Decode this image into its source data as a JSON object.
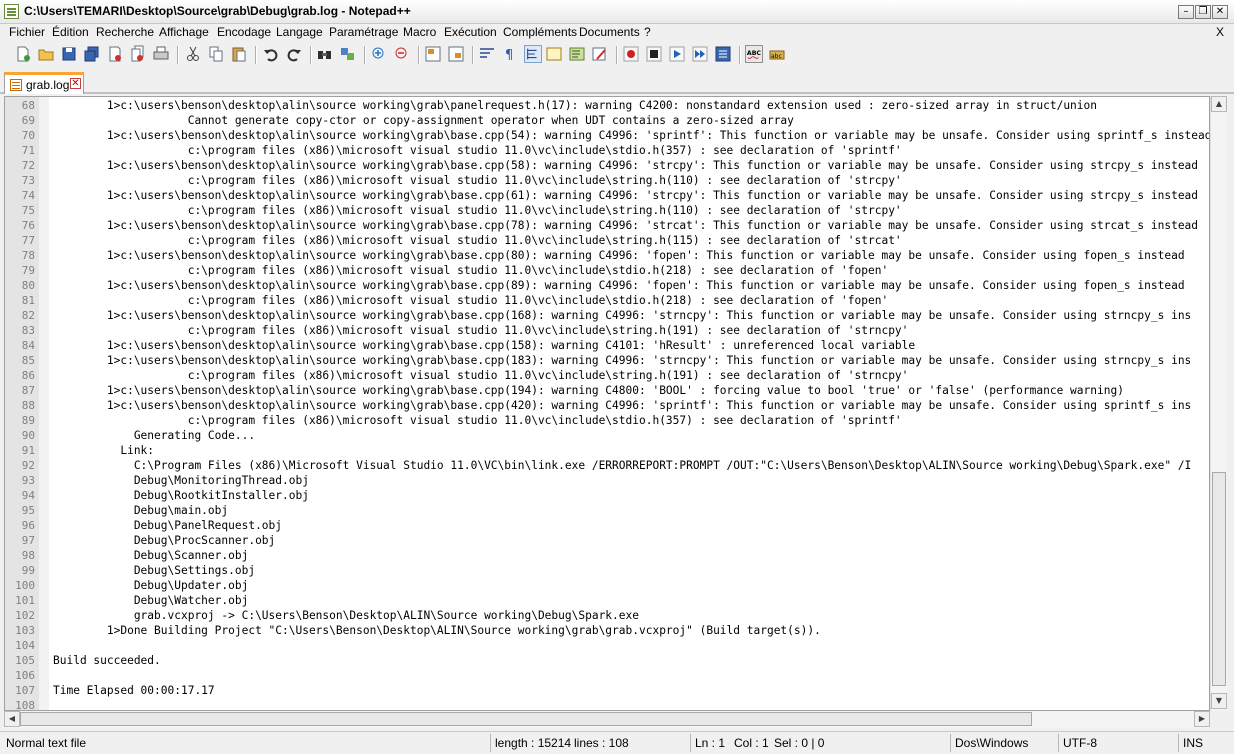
{
  "window": {
    "title": "C:\\Users\\TEMARI\\Desktop\\Source\\grab\\Debug\\grab.log - Notepad++",
    "minimize_icon": "minimize-icon",
    "restore_icon": "restore-icon",
    "close_icon": "close-icon"
  },
  "menu": {
    "items": [
      "Fichier",
      "Édition",
      "Recherche",
      "Affichage",
      "Encodage",
      "Langage",
      "Paramétrage",
      "Macro",
      "Exécution",
      "Compléments",
      "Documents",
      "?"
    ],
    "close_doc": "X"
  },
  "toolbar": {
    "buttons": [
      "new-file-icon",
      "open-file-icon",
      "save-icon",
      "save-all-icon",
      "close-icon",
      "close-all-icon",
      "print-icon",
      "cut-icon",
      "copy-icon",
      "paste-icon",
      "undo-icon",
      "redo-icon",
      "find-icon",
      "replace-icon",
      "zoom-in-icon",
      "zoom-out-icon",
      "sync-vertical-icon",
      "sync-horizontal-icon",
      "word-wrap-icon",
      "show-all-characters-icon",
      "indent-guide-icon",
      "document-map-icon",
      "function-list-icon",
      "folder-workspace-icon",
      "record-macro-icon",
      "stop-macro-icon",
      "play-macro-icon",
      "run-macro-multiple-icon",
      "save-macro-icon",
      "spell-check-icon",
      "spell-check-options-icon"
    ]
  },
  "tab": {
    "label": "grab.log",
    "icon": "document-icon",
    "close_icon": "tab-close-icon"
  },
  "editor": {
    "lines": [
      {
        "n": "68",
        "text": "        1>c:\\users\\benson\\desktop\\alin\\source working\\grab\\panelrequest.h(17): warning C4200: nonstandard extension used : zero-sized array in struct/union"
      },
      {
        "n": "69",
        "text": "                    Cannot generate copy-ctor or copy-assignment operator when UDT contains a zero-sized array"
      },
      {
        "n": "70",
        "text": "        1>c:\\users\\benson\\desktop\\alin\\source working\\grab\\base.cpp(54): warning C4996: 'sprintf': This function or variable may be unsafe. Consider using sprintf_s instead"
      },
      {
        "n": "71",
        "text": "                    c:\\program files (x86)\\microsoft visual studio 11.0\\vc\\include\\stdio.h(357) : see declaration of 'sprintf'"
      },
      {
        "n": "72",
        "text": "        1>c:\\users\\benson\\desktop\\alin\\source working\\grab\\base.cpp(58): warning C4996: 'strcpy': This function or variable may be unsafe. Consider using strcpy_s instead"
      },
      {
        "n": "73",
        "text": "                    c:\\program files (x86)\\microsoft visual studio 11.0\\vc\\include\\string.h(110) : see declaration of 'strcpy'"
      },
      {
        "n": "74",
        "text": "        1>c:\\users\\benson\\desktop\\alin\\source working\\grab\\base.cpp(61): warning C4996: 'strcpy': This function or variable may be unsafe. Consider using strcpy_s instead"
      },
      {
        "n": "75",
        "text": "                    c:\\program files (x86)\\microsoft visual studio 11.0\\vc\\include\\string.h(110) : see declaration of 'strcpy'"
      },
      {
        "n": "76",
        "text": "        1>c:\\users\\benson\\desktop\\alin\\source working\\grab\\base.cpp(78): warning C4996: 'strcat': This function or variable may be unsafe. Consider using strcat_s instead"
      },
      {
        "n": "77",
        "text": "                    c:\\program files (x86)\\microsoft visual studio 11.0\\vc\\include\\string.h(115) : see declaration of 'strcat'"
      },
      {
        "n": "78",
        "text": "        1>c:\\users\\benson\\desktop\\alin\\source working\\grab\\base.cpp(80): warning C4996: 'fopen': This function or variable may be unsafe. Consider using fopen_s instead"
      },
      {
        "n": "79",
        "text": "                    c:\\program files (x86)\\microsoft visual studio 11.0\\vc\\include\\stdio.h(218) : see declaration of 'fopen'"
      },
      {
        "n": "80",
        "text": "        1>c:\\users\\benson\\desktop\\alin\\source working\\grab\\base.cpp(89): warning C4996: 'fopen': This function or variable may be unsafe. Consider using fopen_s instead"
      },
      {
        "n": "81",
        "text": "                    c:\\program files (x86)\\microsoft visual studio 11.0\\vc\\include\\stdio.h(218) : see declaration of 'fopen'"
      },
      {
        "n": "82",
        "text": "        1>c:\\users\\benson\\desktop\\alin\\source working\\grab\\base.cpp(168): warning C4996: 'strncpy': This function or variable may be unsafe. Consider using strncpy_s ins"
      },
      {
        "n": "83",
        "text": "                    c:\\program files (x86)\\microsoft visual studio 11.0\\vc\\include\\string.h(191) : see declaration of 'strncpy'"
      },
      {
        "n": "84",
        "text": "        1>c:\\users\\benson\\desktop\\alin\\source working\\grab\\base.cpp(158): warning C4101: 'hResult' : unreferenced local variable"
      },
      {
        "n": "85",
        "text": "        1>c:\\users\\benson\\desktop\\alin\\source working\\grab\\base.cpp(183): warning C4996: 'strncpy': This function or variable may be unsafe. Consider using strncpy_s ins"
      },
      {
        "n": "86",
        "text": "                    c:\\program files (x86)\\microsoft visual studio 11.0\\vc\\include\\string.h(191) : see declaration of 'strncpy'"
      },
      {
        "n": "87",
        "text": "        1>c:\\users\\benson\\desktop\\alin\\source working\\grab\\base.cpp(194): warning C4800: 'BOOL' : forcing value to bool 'true' or 'false' (performance warning)"
      },
      {
        "n": "88",
        "text": "        1>c:\\users\\benson\\desktop\\alin\\source working\\grab\\base.cpp(420): warning C4996: 'sprintf': This function or variable may be unsafe. Consider using sprintf_s ins"
      },
      {
        "n": "89",
        "text": "                    c:\\program files (x86)\\microsoft visual studio 11.0\\vc\\include\\stdio.h(357) : see declaration of 'sprintf'"
      },
      {
        "n": "90",
        "text": "            Generating Code..."
      },
      {
        "n": "91",
        "text": "          Link:"
      },
      {
        "n": "92",
        "text": "            C:\\Program Files (x86)\\Microsoft Visual Studio 11.0\\VC\\bin\\link.exe /ERRORREPORT:PROMPT /OUT:\"C:\\Users\\Benson\\Desktop\\ALIN\\Source working\\Debug\\Spark.exe\" /I"
      },
      {
        "n": "93",
        "text": "            Debug\\MonitoringThread.obj"
      },
      {
        "n": "94",
        "text": "            Debug\\RootkitInstaller.obj"
      },
      {
        "n": "95",
        "text": "            Debug\\main.obj"
      },
      {
        "n": "96",
        "text": "            Debug\\PanelRequest.obj"
      },
      {
        "n": "97",
        "text": "            Debug\\ProcScanner.obj"
      },
      {
        "n": "98",
        "text": "            Debug\\Scanner.obj"
      },
      {
        "n": "99",
        "text": "            Debug\\Settings.obj"
      },
      {
        "n": "100",
        "text": "            Debug\\Updater.obj"
      },
      {
        "n": "101",
        "text": "            Debug\\Watcher.obj"
      },
      {
        "n": "102",
        "text": "            grab.vcxproj -> C:\\Users\\Benson\\Desktop\\ALIN\\Source working\\Debug\\Spark.exe"
      },
      {
        "n": "103",
        "text": "        1>Done Building Project \"C:\\Users\\Benson\\Desktop\\ALIN\\Source working\\grab\\grab.vcxproj\" (Build target(s))."
      },
      {
        "n": "104",
        "text": ""
      },
      {
        "n": "105",
        "text": "Build succeeded."
      },
      {
        "n": "106",
        "text": ""
      },
      {
        "n": "107",
        "text": "Time Elapsed 00:00:17.17"
      },
      {
        "n": "108",
        "text": ""
      }
    ]
  },
  "scrollbar": {
    "up_icon": "scroll-up-arrow-icon",
    "down_icon": "scroll-down-arrow-icon",
    "left_icon": "scroll-left-arrow-icon",
    "right_icon": "scroll-right-arrow-icon"
  },
  "status": {
    "file_type": "Normal text file",
    "length": "length : 15214",
    "lines": "lines : 108",
    "ln": "Ln : 1",
    "col": "Col : 1",
    "sel": "Sel : 0 | 0",
    "eol": "Dos\\Windows",
    "encoding": "UTF-8",
    "mode": "INS"
  }
}
